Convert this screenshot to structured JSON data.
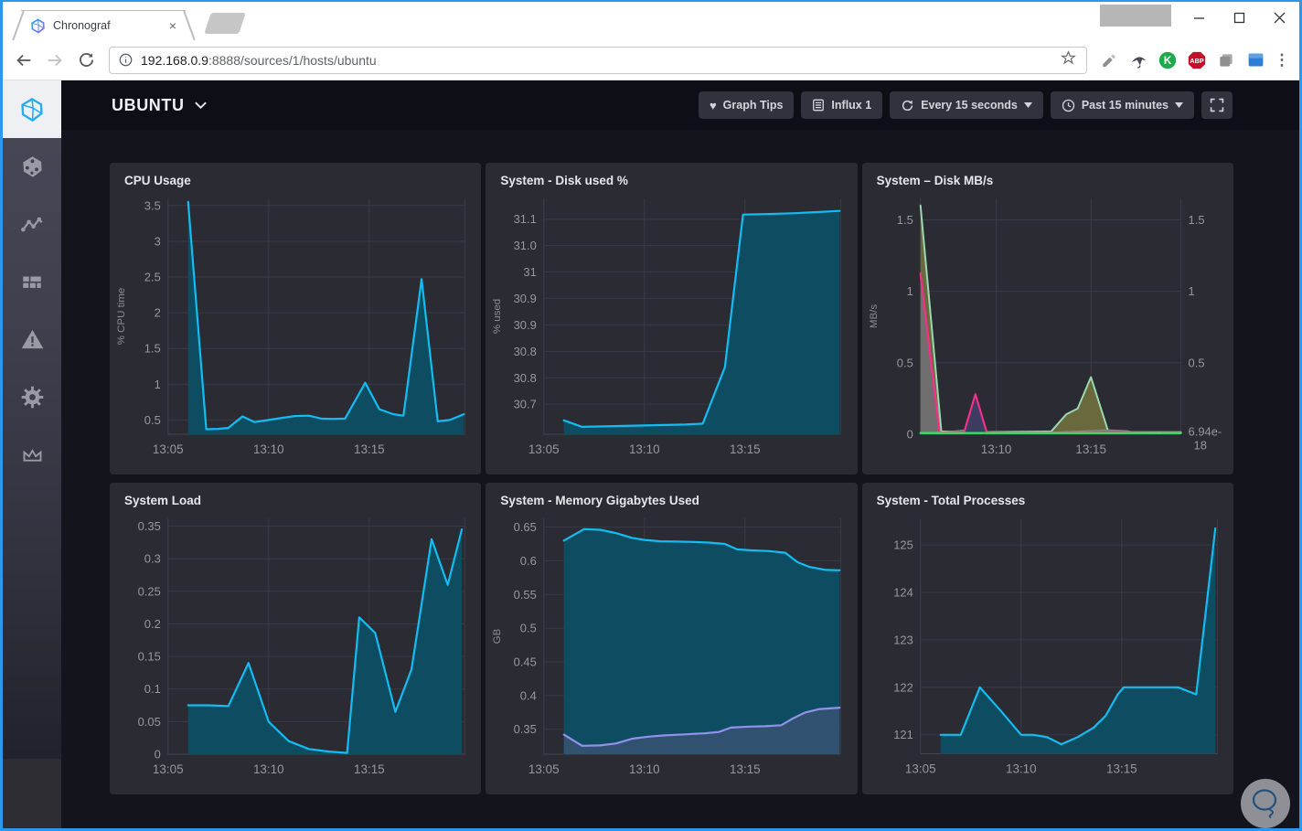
{
  "browser": {
    "tab_title": "Chronograf",
    "close_tab": "×",
    "url_host": "192.168.0.9",
    "url_path": ":8888/sources/1/hosts/ubuntu",
    "ext_k_label": "K",
    "ext_abp_label": "ABP",
    "menu_dots": "⋮"
  },
  "header": {
    "host_title": "UBUNTU",
    "graph_tips_label": "Graph Tips",
    "source_label": "Influx 1",
    "refresh_interval_label": "Every 15 seconds",
    "time_range_label": "Past 15 minutes"
  },
  "sidebar": {
    "icons": [
      "chronograf-logo",
      "hosts",
      "data-explorer",
      "dashboards",
      "alerts",
      "admin-gear",
      "crown"
    ],
    "active_index": 0
  },
  "colors": {
    "accent_blue": "#22ADF6",
    "line_blue": "#11bdf2",
    "fill_blue": "#0d4c61",
    "magenta": "#f62e8a",
    "green": "#2ee45e",
    "seafoam": "#9bd8b1",
    "olive_fill": "#6a693e",
    "gray_fill": "#6f6f6f",
    "navy_fill": "#3c3c60",
    "lavender": "#9192ea",
    "lavender_fill": "#315170",
    "panel_bg": "#2b2b33",
    "window_border": "#2b97ee"
  },
  "chart_data": [
    {
      "type": "area",
      "title": "CPU Usage",
      "ylabel": "% CPU time",
      "xlim": [
        0,
        14.75
      ],
      "ylim": [
        0.3,
        3.6
      ],
      "xticks": [
        {
          "v": 0,
          "l": "13:05"
        },
        {
          "v": 5,
          "l": "13:10"
        },
        {
          "v": 10,
          "l": "13:15"
        }
      ],
      "yticks": [
        {
          "v": 0.5,
          "l": "0.5"
        },
        {
          "v": 1,
          "l": "1"
        },
        {
          "v": 1.5,
          "l": "1.5"
        },
        {
          "v": 2,
          "l": "2"
        },
        {
          "v": 2.5,
          "l": "2.5"
        },
        {
          "v": 3,
          "l": "3"
        },
        {
          "v": 3.5,
          "l": "3.5"
        }
      ],
      "series": [
        {
          "name": "cpu",
          "color": "#11bdf2",
          "w": 2.2,
          "fill": "#0d4c61",
          "points": [
            [
              1,
              3.55
            ],
            [
              1.9,
              0.37
            ],
            [
              2.5,
              0.375
            ],
            [
              3,
              0.39
            ],
            [
              3.7,
              0.55
            ],
            [
              4.3,
              0.47
            ],
            [
              5,
              0.5
            ],
            [
              5.7,
              0.53
            ],
            [
              6.3,
              0.555
            ],
            [
              7,
              0.56
            ],
            [
              7.6,
              0.52
            ],
            [
              8.2,
              0.515
            ],
            [
              8.8,
              0.52
            ],
            [
              9.8,
              1.02
            ],
            [
              10.5,
              0.65
            ],
            [
              11.2,
              0.58
            ],
            [
              11.7,
              0.56
            ],
            [
              12.6,
              2.47
            ],
            [
              13.4,
              0.48
            ],
            [
              14,
              0.5
            ],
            [
              14.7,
              0.58
            ]
          ]
        }
      ]
    },
    {
      "type": "area",
      "title": "System - Disk used %",
      "ylabel": "% used",
      "xlim": [
        0,
        14.75
      ],
      "ylim": [
        30.635,
        31.145
      ],
      "xticks": [
        {
          "v": 0,
          "l": "13:05"
        },
        {
          "v": 5,
          "l": "13:10"
        },
        {
          "v": 10,
          "l": "13:15"
        }
      ],
      "yticks": [
        {
          "v": 30.7,
          "l": "30.7"
        },
        {
          "v": 30.757,
          "l": "30.8"
        },
        {
          "v": 30.814,
          "l": "30.8"
        },
        {
          "v": 30.871,
          "l": "30.9"
        },
        {
          "v": 30.929,
          "l": "30.9"
        },
        {
          "v": 30.986,
          "l": "31"
        },
        {
          "v": 31.043,
          "l": "31.0"
        },
        {
          "v": 31.1,
          "l": "31.1"
        }
      ],
      "series": [
        {
          "name": "disk_used",
          "color": "#11bdf2",
          "w": 2.2,
          "fill": "#0d4c61",
          "points": [
            [
              1,
              30.665
            ],
            [
              1.9,
              30.651
            ],
            [
              3,
              30.652
            ],
            [
              5,
              30.654
            ],
            [
              7,
              30.656
            ],
            [
              7.9,
              30.658
            ],
            [
              9,
              30.78
            ],
            [
              9.9,
              31.11
            ],
            [
              11,
              31.111
            ],
            [
              12.5,
              31.113
            ],
            [
              14.7,
              31.118
            ]
          ]
        }
      ]
    },
    {
      "type": "area",
      "title": "System – Disk MB/s",
      "ylabel": "MB/s",
      "mr": 54,
      "xlim": [
        1,
        14.75
      ],
      "ylim": [
        0,
        1.65
      ],
      "xticks": [
        {
          "v": 5,
          "l": "13:10"
        },
        {
          "v": 10,
          "l": "13:15"
        }
      ],
      "yticks": [
        {
          "v": 0,
          "l": "0"
        },
        {
          "v": 0.5,
          "l": "0.5"
        },
        {
          "v": 1,
          "l": "1"
        },
        {
          "v": 1.5,
          "l": "1.5"
        }
      ],
      "right_yticks": [
        {
          "v": 1.5,
          "l": "1.5"
        },
        {
          "v": 1,
          "l": "1"
        },
        {
          "v": 0.5,
          "l": "0.5"
        },
        {
          "v": 0.02,
          "l": "6.94e-|18"
        }
      ],
      "series": [
        {
          "name": "disk_write",
          "color": "#9bd8b1",
          "w": 2,
          "fill": "#6a693e",
          "points": [
            [
              1,
              1.6
            ],
            [
              2.1,
              0.02
            ],
            [
              4,
              0.015
            ],
            [
              7.9,
              0.02
            ],
            [
              8.7,
              0.14
            ],
            [
              9.3,
              0.18
            ],
            [
              10,
              0.4
            ],
            [
              10.9,
              0.025
            ],
            [
              12,
              0.015
            ],
            [
              14.75,
              0.015
            ]
          ]
        },
        {
          "name": "disk_other",
          "color": "#8f8f8f",
          "w": 1,
          "fill": "#6f6f6f",
          "points": [
            [
              1,
              1.13
            ],
            [
              2.05,
              0.015
            ],
            [
              3.4,
              0.03
            ],
            [
              3.9,
              0.07
            ],
            [
              4.4,
              0.02
            ],
            [
              5,
              0.01
            ],
            [
              7,
              0.01
            ],
            [
              11,
              0.03
            ],
            [
              11.9,
              0.025
            ],
            [
              12.4,
              0.01
            ],
            [
              14.75,
              0.01
            ]
          ]
        },
        {
          "name": "disk_read_fill",
          "color": "",
          "w": 0,
          "fill": "#3c3c60",
          "points": [
            [
              3.3,
              0.012
            ],
            [
              3.9,
              0.28
            ],
            [
              4.5,
              0.012
            ]
          ]
        },
        {
          "name": "disk_read",
          "color": "#f62e8a",
          "w": 2.2,
          "fill": "",
          "points": [
            [
              1,
              1.12
            ],
            [
              2,
              0.012
            ],
            [
              3.3,
              0.012
            ],
            [
              3.9,
              0.28
            ],
            [
              4.5,
              0.012
            ],
            [
              6,
              0.01
            ],
            [
              9,
              0.012
            ],
            [
              10,
              0.014
            ],
            [
              11.3,
              0.02
            ],
            [
              12,
              0.012
            ],
            [
              14.75,
              0.01
            ]
          ]
        },
        {
          "name": "disk_zero",
          "color": "#2ee45e",
          "w": 2.4,
          "fill": "",
          "points": [
            [
              1,
              0.008
            ],
            [
              14.75,
              0.008
            ]
          ]
        }
      ]
    },
    {
      "type": "area",
      "title": "System Load",
      "ylabel": "",
      "xlim": [
        0,
        14.75
      ],
      "ylim": [
        0,
        0.362
      ],
      "xticks": [
        {
          "v": 0,
          "l": "13:05"
        },
        {
          "v": 5,
          "l": "13:10"
        },
        {
          "v": 10,
          "l": "13:15"
        }
      ],
      "yticks": [
        {
          "v": 0,
          "l": "0"
        },
        {
          "v": 0.05,
          "l": "0.05"
        },
        {
          "v": 0.1,
          "l": "0.1"
        },
        {
          "v": 0.15,
          "l": "0.15"
        },
        {
          "v": 0.2,
          "l": "0.2"
        },
        {
          "v": 0.25,
          "l": "0.25"
        },
        {
          "v": 0.3,
          "l": "0.3"
        },
        {
          "v": 0.35,
          "l": "0.35"
        }
      ],
      "series": [
        {
          "name": "load1",
          "color": "#11bdf2",
          "w": 2.2,
          "fill": "#0d4c61",
          "points": [
            [
              1,
              0.075
            ],
            [
              2,
              0.075
            ],
            [
              3,
              0.074
            ],
            [
              4,
              0.14
            ],
            [
              5,
              0.05
            ],
            [
              6,
              0.02
            ],
            [
              7,
              0.008
            ],
            [
              8,
              0.004
            ],
            [
              8.9,
              0.002
            ],
            [
              9.5,
              0.21
            ],
            [
              10.3,
              0.186
            ],
            [
              11.3,
              0.065
            ],
            [
              12.1,
              0.13
            ],
            [
              13.1,
              0.33
            ],
            [
              13.9,
              0.26
            ],
            [
              14.6,
              0.345
            ]
          ]
        }
      ]
    },
    {
      "type": "area",
      "title": "System - Memory Gigabytes Used",
      "ylabel": "GB",
      "xlim": [
        0,
        14.75
      ],
      "ylim": [
        0.313,
        0.663
      ],
      "xticks": [
        {
          "v": 0,
          "l": "13:05"
        },
        {
          "v": 5,
          "l": "13:10"
        },
        {
          "v": 10,
          "l": "13:15"
        }
      ],
      "yticks": [
        {
          "v": 0.35,
          "l": "0.35"
        },
        {
          "v": 0.4,
          "l": "0.4"
        },
        {
          "v": 0.45,
          "l": "0.45"
        },
        {
          "v": 0.5,
          "l": "0.5"
        },
        {
          "v": 0.55,
          "l": "0.55"
        },
        {
          "v": 0.6,
          "l": "0.6"
        },
        {
          "v": 0.65,
          "l": "0.65"
        }
      ],
      "series": [
        {
          "name": "mem_used",
          "color": "#11bdf2",
          "w": 2.2,
          "fill": "#0d4c61",
          "points": [
            [
              1,
              0.63
            ],
            [
              2,
              0.647
            ],
            [
              2.8,
              0.646
            ],
            [
              3.6,
              0.641
            ],
            [
              4.4,
              0.634
            ],
            [
              5,
              0.631
            ],
            [
              5.8,
              0.629
            ],
            [
              6.6,
              0.6285
            ],
            [
              7.4,
              0.628
            ],
            [
              8.2,
              0.627
            ],
            [
              9,
              0.625
            ],
            [
              9.6,
              0.617
            ],
            [
              10.3,
              0.6155
            ],
            [
              11.2,
              0.6145
            ],
            [
              12,
              0.612
            ],
            [
              12.6,
              0.598
            ],
            [
              13.2,
              0.591
            ],
            [
              14,
              0.5865
            ],
            [
              14.7,
              0.586
            ]
          ]
        },
        {
          "name": "mem_cached",
          "color": "#9192ea",
          "w": 2.2,
          "fill": "#315170",
          "points": [
            [
              1,
              0.342
            ],
            [
              1.9,
              0.3255
            ],
            [
              2.8,
              0.326
            ],
            [
              3.6,
              0.329
            ],
            [
              4.4,
              0.336
            ],
            [
              5.2,
              0.339
            ],
            [
              6,
              0.341
            ],
            [
              7,
              0.3425
            ],
            [
              8,
              0.344
            ],
            [
              8.7,
              0.346
            ],
            [
              9.3,
              0.3525
            ],
            [
              10.2,
              0.354
            ],
            [
              11,
              0.3545
            ],
            [
              11.8,
              0.356
            ],
            [
              12.4,
              0.3665
            ],
            [
              13,
              0.375
            ],
            [
              13.7,
              0.38
            ],
            [
              14.7,
              0.382
            ]
          ]
        }
      ]
    },
    {
      "type": "area",
      "title": "System - Total Processes",
      "ylabel": "",
      "xlim": [
        0,
        14.75
      ],
      "ylim": [
        120.6,
        125.55
      ],
      "xticks": [
        {
          "v": 0,
          "l": "13:05"
        },
        {
          "v": 5,
          "l": "13:10"
        },
        {
          "v": 10,
          "l": "13:15"
        }
      ],
      "yticks": [
        {
          "v": 121,
          "l": "121"
        },
        {
          "v": 122,
          "l": "122"
        },
        {
          "v": 123,
          "l": "123"
        },
        {
          "v": 124,
          "l": "124"
        },
        {
          "v": 125,
          "l": "125"
        }
      ],
      "series": [
        {
          "name": "processes",
          "color": "#11bdf2",
          "w": 2.2,
          "fill": "#0d4c61",
          "points": [
            [
              1,
              121
            ],
            [
              2,
              121
            ],
            [
              2.95,
              122
            ],
            [
              4,
              121.5
            ],
            [
              5,
              121
            ],
            [
              5.6,
              121
            ],
            [
              6.3,
              120.95
            ],
            [
              7,
              120.8
            ],
            [
              7.8,
              120.95
            ],
            [
              8.6,
              121.15
            ],
            [
              9.2,
              121.4
            ],
            [
              9.8,
              121.85
            ],
            [
              10.1,
              122
            ],
            [
              12.8,
              122
            ],
            [
              13.7,
              121.85
            ],
            [
              14.65,
              125.35
            ]
          ]
        }
      ]
    }
  ]
}
